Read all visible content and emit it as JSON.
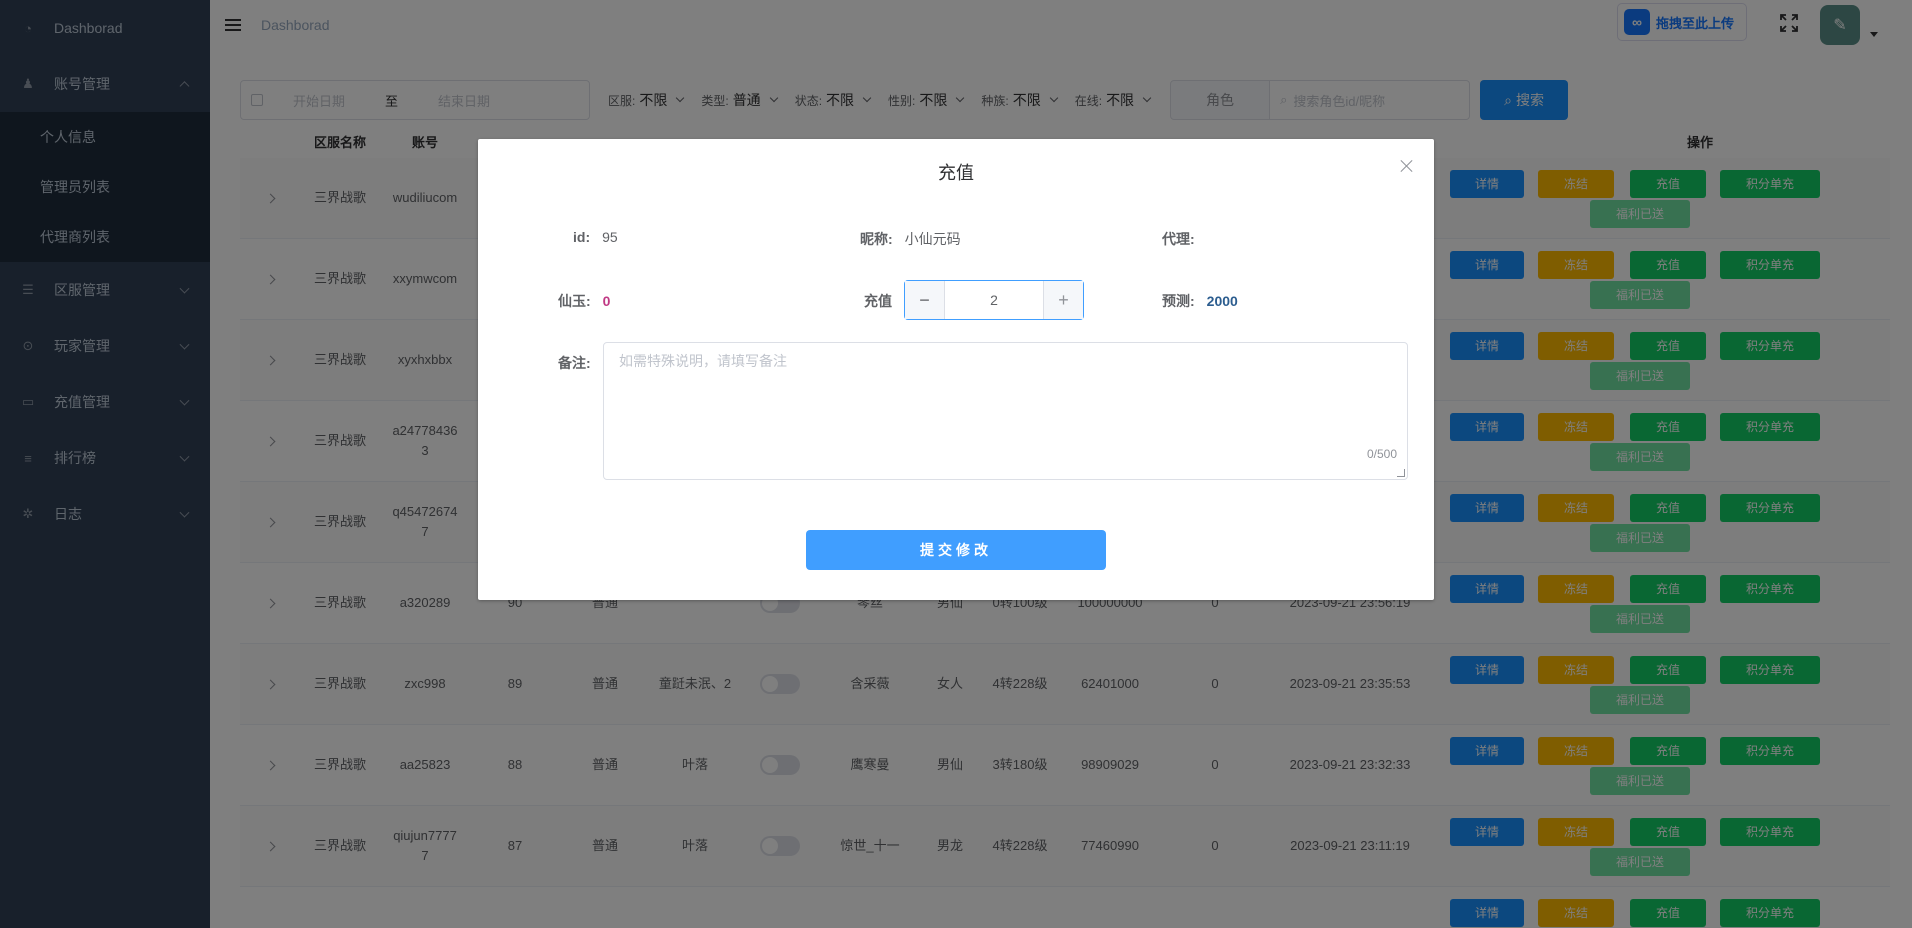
{
  "sidebar": {
    "items": [
      {
        "label": "Dashborad",
        "icon": "dashboard-icon"
      },
      {
        "label": "账号管理",
        "icon": "users-icon",
        "expanded": true,
        "children": [
          {
            "label": "个人信息"
          },
          {
            "label": "管理员列表"
          },
          {
            "label": "代理商列表"
          }
        ]
      },
      {
        "label": "区服管理",
        "icon": "list-icon"
      },
      {
        "label": "玩家管理",
        "icon": "gamepad-icon"
      },
      {
        "label": "充值管理",
        "icon": "money-icon"
      },
      {
        "label": "排行榜",
        "icon": "rank-icon"
      },
      {
        "label": "日志",
        "icon": "bug-icon"
      }
    ]
  },
  "navbar": {
    "breadcrumb": "Dashborad",
    "upload_label": "拖拽至此上传"
  },
  "filters": {
    "start_placeholder": "开始日期",
    "range_sep": "至",
    "end_placeholder": "结束日期",
    "selects": [
      {
        "label": "区服:",
        "value": "不限"
      },
      {
        "label": "类型:",
        "value": "普通"
      },
      {
        "label": "状态:",
        "value": "不限"
      },
      {
        "label": "性别:",
        "value": "不限"
      },
      {
        "label": "种族:",
        "value": "不限"
      },
      {
        "label": "在线:",
        "value": "不限"
      }
    ],
    "role_select": "角色",
    "search_placeholder": "搜索角色id/昵称",
    "search_button": "搜索"
  },
  "table": {
    "headers": {
      "server": "区服名称",
      "account": "账号",
      "ops": "操作"
    },
    "ops": {
      "detail": "详情",
      "freeze": "冻结",
      "charge": "充值",
      "score": "积分单充",
      "welfare": "福利已送"
    },
    "rows": [
      {
        "server": "三界战歌",
        "account": "wudiliucom",
        "id": "",
        "type": "",
        "guild": "",
        "nick": "",
        "role": "",
        "level": "",
        "power": "",
        "count": "",
        "time": ""
      },
      {
        "server": "三界战歌",
        "account": "xxymwcom",
        "id": "",
        "type": "",
        "guild": "",
        "nick": "",
        "role": "",
        "level": "",
        "power": "",
        "count": "",
        "time": ""
      },
      {
        "server": "三界战歌",
        "account": "xyxhxbbx",
        "id": "",
        "type": "",
        "guild": "",
        "nick": "",
        "role": "",
        "level": "",
        "power": "",
        "count": "",
        "time": ""
      },
      {
        "server": "三界战歌",
        "account": "a247784363",
        "id": "",
        "type": "",
        "guild": "",
        "nick": "",
        "role": "",
        "level": "",
        "power": "",
        "count": "",
        "time": ""
      },
      {
        "server": "三界战歌",
        "account": "q454726747",
        "id": "",
        "type": "",
        "guild": "",
        "nick": "",
        "role": "",
        "level": "",
        "power": "",
        "count": "",
        "time": ""
      },
      {
        "server": "三界战歌",
        "account": "a320289",
        "id": "90",
        "type": "普通",
        "guild": "",
        "nick": "琴丝",
        "role": "男仙",
        "level": "0转100级",
        "power": "100000000",
        "count": "0",
        "time": "2023-09-21 23:56:19"
      },
      {
        "server": "三界战歌",
        "account": "zxc998",
        "id": "89",
        "type": "普通",
        "guild": "童跹未泯、2",
        "nick": "含采薇",
        "role": "女人",
        "level": "4转228级",
        "power": "62401000",
        "count": "0",
        "time": "2023-09-21 23:35:53"
      },
      {
        "server": "三界战歌",
        "account": "aa25823",
        "id": "88",
        "type": "普通",
        "guild": "叶落",
        "nick": "鹰寒曼",
        "role": "男仙",
        "level": "3转180级",
        "power": "98909029",
        "count": "0",
        "time": "2023-09-21 23:32:33"
      },
      {
        "server": "三界战歌",
        "account": "qiujun77777",
        "id": "87",
        "type": "普通",
        "guild": "叶落",
        "nick": "惊世_十一",
        "role": "男龙",
        "level": "4转228级",
        "power": "77460990",
        "count": "0",
        "time": "2023-09-21 23:11:19"
      },
      {
        "server": "",
        "account": "",
        "id": "",
        "type": "",
        "guild": "",
        "nick": "",
        "role": "",
        "level": "",
        "power": "",
        "count": "",
        "time": ""
      }
    ]
  },
  "dialog": {
    "title": "充值",
    "id_label": "id:",
    "id_value": "95",
    "nick_label": "昵称:",
    "nick_value": "小仙元码",
    "agent_label": "代理:",
    "agent_value": "",
    "jade_label": "仙玉:",
    "jade_value": "0",
    "charge_label": "充值",
    "charge_value": "2",
    "predict_label": "预测:",
    "predict_value": "2000",
    "remark_label": "备注:",
    "remark_placeholder": "如需特殊说明，请填写备注",
    "remark_counter": "0/500",
    "submit_label": "提交修改",
    "accent_color": "#409eff"
  }
}
